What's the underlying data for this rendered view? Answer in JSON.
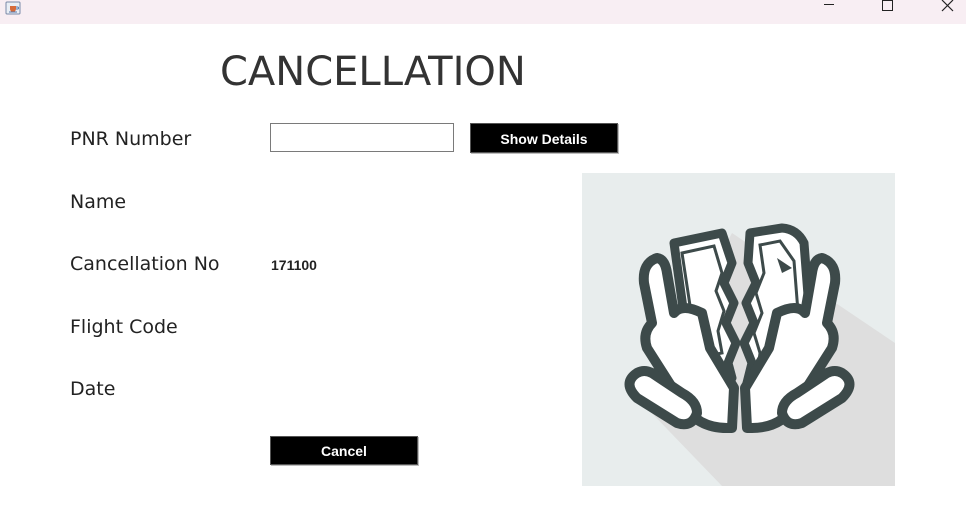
{
  "window": {
    "app_icon": "java-cup-icon",
    "controls": {
      "minimize": "minimize-icon",
      "maximize": "maximize-icon",
      "close": "close-icon"
    }
  },
  "form": {
    "title": "CANCELLATION",
    "pnr_label": "PNR Number",
    "pnr_value": "",
    "show_details_label": "Show Details",
    "name_label": "Name",
    "cancellation_no_label": "Cancellation No",
    "cancellation_no_value": "171100",
    "flight_code_label": "Flight Code",
    "date_label": "Date",
    "cancel_label": "Cancel"
  },
  "illustration": {
    "icon": "torn-ticket-hands-icon",
    "colors": {
      "background": "#e8eded",
      "shadow": "#dedede",
      "stroke": "#3d4a4a",
      "fill": "#ffffff"
    }
  }
}
